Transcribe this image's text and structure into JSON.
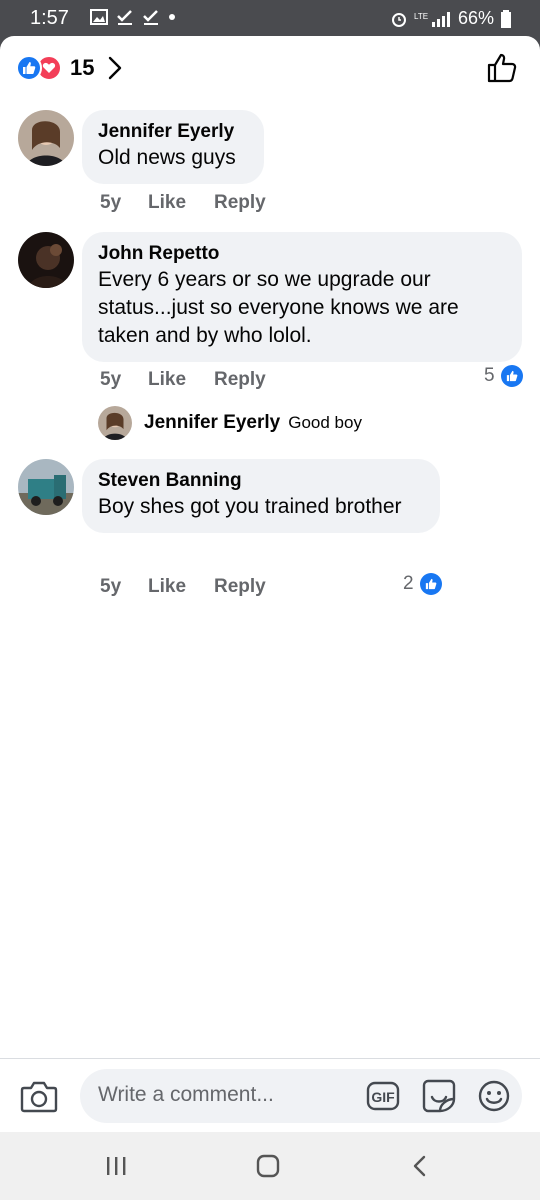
{
  "status_bar": {
    "time": "1:57",
    "battery": "66%",
    "network": "LTE"
  },
  "reactions": {
    "count": "15",
    "icons": [
      "like-icon",
      "love-icon"
    ]
  },
  "comments": [
    {
      "author": "Jennifer Eyerly",
      "text": "Old news guys",
      "time": "5y",
      "like_label": "Like",
      "reply_label": "Reply"
    },
    {
      "author": "John Repetto",
      "text": "Every 6 years or so we upgrade our status...just so everyone knows we are taken and by who lolol.",
      "time": "5y",
      "like_label": "Like",
      "reply_label": "Reply",
      "likes": "5",
      "reply": {
        "author": "Jennifer Eyerly",
        "text": "Good boy"
      }
    },
    {
      "author": "Steven Banning",
      "text": "Boy shes got you trained brother",
      "time": "5y",
      "like_label": "Like",
      "reply_label": "Reply",
      "likes": "2"
    }
  ],
  "composer": {
    "placeholder": "Write a comment...",
    "gif_label": "GIF"
  },
  "colors": {
    "accent": "#1877f2",
    "love": "#f33e58",
    "bubble": "#f0f2f5",
    "secondary_text": "#65676b"
  }
}
